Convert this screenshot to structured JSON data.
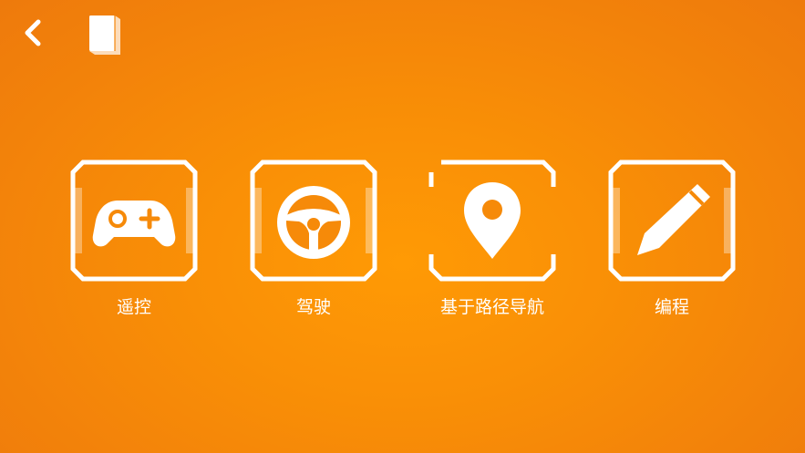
{
  "header": {
    "back_icon": "chevron-left-icon",
    "book_icon": "book-icon"
  },
  "menu": {
    "items": [
      {
        "label": "遥控",
        "icon": "gamepad-icon"
      },
      {
        "label": "驾驶",
        "icon": "steering-wheel-icon"
      },
      {
        "label": "基于路径导航",
        "icon": "map-pin-icon"
      },
      {
        "label": "编程",
        "icon": "pencil-icon"
      }
    ]
  },
  "colors": {
    "background": "#f6870a",
    "foreground": "#ffffff"
  }
}
